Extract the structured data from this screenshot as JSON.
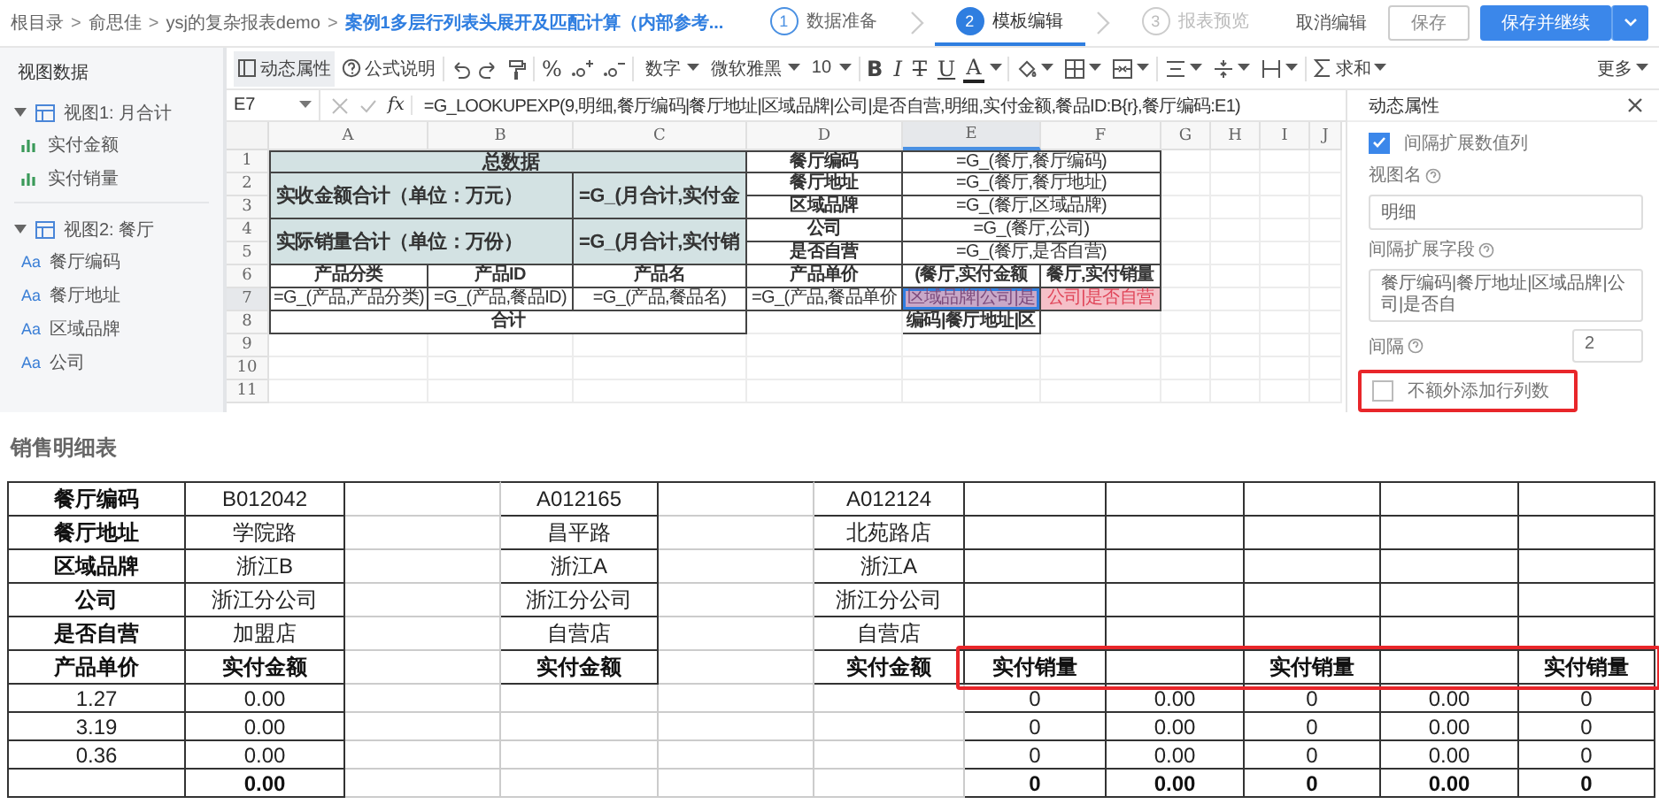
{
  "breadcrumb": [
    {
      "label": "根目录",
      "sep": ">"
    },
    {
      "label": "俞思佳",
      "sep": ">"
    },
    {
      "label": "ysj的复杂报表demo",
      "sep": ">"
    },
    {
      "label": "案例1多层行列表头展开及匹配计算（内部参考..."
    }
  ],
  "steps": [
    {
      "number": "1",
      "label": "数据准备",
      "selected": false,
      "disabled": false
    },
    {
      "number": "2",
      "label": "模板编辑",
      "selected": true,
      "disabled": false
    },
    {
      "number": "3",
      "label": "报表预览",
      "selected": false,
      "disabled": true
    }
  ],
  "actions": {
    "cancel": "取消编辑",
    "save": "保存",
    "save_continue": "保存并继续"
  },
  "sidebar": {
    "title": "视图数据",
    "views": [
      {
        "label": "视图1: 月合计",
        "expanded": true,
        "fields": [
          {
            "kind": "measure",
            "label": "实付金额"
          },
          {
            "kind": "measure",
            "label": "实付销量"
          }
        ]
      },
      {
        "label": "视图2: 餐厅",
        "expanded": true,
        "fields": [
          {
            "kind": "dimension",
            "badge": "Aa",
            "label": "餐厅编码"
          },
          {
            "kind": "dimension",
            "badge": "Aa",
            "label": "餐厅地址"
          },
          {
            "kind": "dimension",
            "badge": "Aa",
            "label": "区域品牌"
          },
          {
            "kind": "dimension",
            "badge": "Aa",
            "label": "公司"
          }
        ]
      }
    ]
  },
  "toolbar": {
    "dynamic_props": "动态属性",
    "formula_help": "公式说明",
    "percent": "%",
    "number_format": "数字",
    "font": "微软雅黑",
    "font_size": "10",
    "bold": "B",
    "italic": "I",
    "strike": "T",
    "underline": "U",
    "font_color": "A",
    "sum": "求和",
    "more": "更多"
  },
  "sheet": {
    "name_box": "E7",
    "fx": "fx",
    "formula": "=G_LOOKUPEXP(9,明细,餐厅编码|餐厅地址|区域品牌|公司|是否自营,明细,实付金额,餐品ID:B{r},餐厅编码:E1)",
    "columns": [
      "A",
      "B",
      "C",
      "D",
      "E",
      "F",
      "G",
      "H",
      "I",
      "J"
    ],
    "rows": [
      "1",
      "2",
      "3",
      "4",
      "5",
      "6",
      "7",
      "8",
      "9",
      "10",
      "11"
    ],
    "cells": [
      {
        "text": "总数据",
        "kind": "title",
        "selected": false
      },
      {
        "text": "餐厅编码",
        "kind": "label",
        "selected": false
      },
      {
        "text": "=G_(餐厅,餐厅编码)",
        "kind": "formula",
        "selected": false
      },
      {
        "text": "实收金额合计（单位：万元）",
        "kind": "title",
        "selected": false
      },
      {
        "text": "=G_(月合计,实付金",
        "kind": "title",
        "selected": false
      },
      {
        "text": "餐厅地址",
        "kind": "label",
        "selected": false
      },
      {
        "text": "=G_(餐厅,餐厅地址)",
        "kind": "formula",
        "selected": false
      },
      {
        "text": "区域品牌",
        "kind": "label",
        "selected": false
      },
      {
        "text": "=G_(餐厅,区域品牌)",
        "kind": "formula",
        "selected": false
      },
      {
        "text": "实际销量合计（单位：万份）",
        "kind": "title",
        "selected": false
      },
      {
        "text": "=G_(月合计,实付销",
        "kind": "title",
        "selected": false
      },
      {
        "text": "公司",
        "kind": "label",
        "selected": false
      },
      {
        "text": "=G_(餐厅,公司)",
        "kind": "formula",
        "selected": false
      },
      {
        "text": "是否自营",
        "kind": "label",
        "selected": false
      },
      {
        "text": "=G_(餐厅,是否自营)",
        "kind": "formula",
        "selected": false
      },
      {
        "text": "产品分类",
        "kind": "label",
        "selected": false
      },
      {
        "text": "产品ID",
        "kind": "label",
        "selected": false
      },
      {
        "text": "产品名",
        "kind": "label",
        "selected": false
      },
      {
        "text": "产品单价",
        "kind": "label",
        "selected": false
      },
      {
        "text": "(餐厅,实付金额",
        "kind": "label",
        "selected": false
      },
      {
        "text": "餐厅,实付销量",
        "kind": "label",
        "selected": false
      },
      {
        "text": "=G_(产品,产品分类)",
        "kind": "formula",
        "selected": false
      },
      {
        "text": "=G_(产品,餐品ID)",
        "kind": "formula",
        "selected": false
      },
      {
        "text": "=G_(产品,餐品名)",
        "kind": "formula",
        "selected": false
      },
      {
        "text": "=G_(产品,餐品单价",
        "kind": "formula",
        "selected": false
      },
      {
        "text": "区域品牌|公司|是",
        "kind": "expand-a",
        "selected": true
      },
      {
        "text": "公司|是否自营",
        "kind": "expand-b",
        "selected": false
      },
      {
        "text": "合计",
        "kind": "label",
        "selected": false
      },
      {
        "text": "编码|餐厅地址|区",
        "kind": "label",
        "selected": false
      }
    ]
  },
  "panel": {
    "title": "动态属性",
    "interval_expand": {
      "label": "间隔扩展数值列",
      "checked": true
    },
    "view_name": {
      "label": "视图名",
      "value": "明细"
    },
    "expand_fields": {
      "label": "间隔扩展字段",
      "value": "餐厅编码|餐厅地址|区域品牌|公司|是否自"
    },
    "interval": {
      "label": "间隔",
      "value": "2"
    },
    "no_extra": {
      "label": "不额外添加行列数",
      "checked": false,
      "highlighted": true
    }
  },
  "report": {
    "title": "销售明细表",
    "rows": [
      {
        "kind": "field",
        "cells": [
          "餐厅编码",
          "B012042",
          null,
          "A012165",
          null,
          "A012124",
          null,
          null,
          null,
          null,
          null
        ]
      },
      {
        "kind": "field",
        "cells": [
          "餐厅地址",
          "学院路",
          null,
          "昌平路",
          null,
          "北苑路店",
          null,
          null,
          null,
          null,
          null
        ]
      },
      {
        "kind": "field",
        "cells": [
          "区域品牌",
          "浙江B",
          null,
          "浙江A",
          null,
          "浙江A",
          null,
          null,
          null,
          null,
          null
        ]
      },
      {
        "kind": "field",
        "cells": [
          "公司",
          "浙江分公司",
          null,
          "浙江分公司",
          null,
          "浙江分公司",
          null,
          null,
          null,
          null,
          null
        ]
      },
      {
        "kind": "field",
        "cells": [
          "是否自营",
          "加盟店",
          null,
          "自营店",
          null,
          "自营店",
          null,
          null,
          null,
          null,
          null
        ]
      },
      {
        "kind": "header",
        "cells": [
          "产品单价",
          "实付金额",
          null,
          "实付金额",
          null,
          "实付金额",
          "实付销量",
          null,
          "实付销量",
          null,
          "实付销量"
        ],
        "highlighted": true
      },
      {
        "kind": "data",
        "cells": [
          "1.27",
          "0.00",
          null,
          null,
          null,
          null,
          "0",
          "0.00",
          "0",
          "0.00",
          "0"
        ]
      },
      {
        "kind": "data",
        "cells": [
          "3.19",
          "0.00",
          null,
          null,
          null,
          null,
          "0",
          "0.00",
          "0",
          "0.00",
          "0"
        ]
      },
      {
        "kind": "data",
        "cells": [
          "0.36",
          "0.00",
          null,
          null,
          null,
          null,
          "0",
          "0.00",
          "0",
          "0.00",
          "0"
        ]
      },
      {
        "kind": "total",
        "cells": [
          null,
          "0.00",
          null,
          null,
          null,
          null,
          "0",
          "0.00",
          "0",
          "0.00",
          "0"
        ]
      }
    ]
  }
}
